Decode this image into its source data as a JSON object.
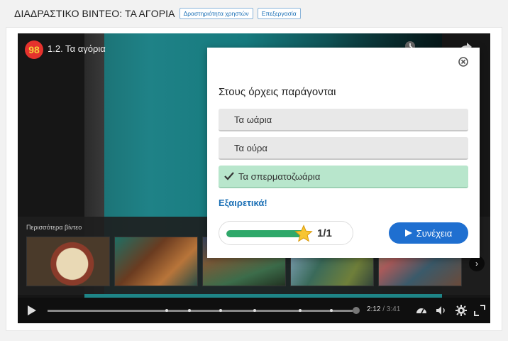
{
  "header": {
    "title": "ΔΙΑΔΡΑΣΤΙΚΟ ΒΙΝΤΕΟ: ΤΑ ΑΓΟΡΙΑ",
    "user_activity_label": "Δραστηριότητα χρηστών",
    "edit_label": "Επεξεργασία"
  },
  "video": {
    "channel_logo_text": "98",
    "title": "1.2. Τα αγόρια",
    "more_videos_label": "Περισσότερα βίντεο",
    "current_time": "2:12",
    "total_time": "/ 3:41",
    "progress_fraction": 1.0
  },
  "quiz": {
    "question": "Στους όρχεις παράγονται",
    "answers": [
      {
        "label": "Τα ωάρια",
        "state": "normal"
      },
      {
        "label": "Τα ούρα",
        "state": "normal"
      },
      {
        "label": "Τα σπερματοζωάρια",
        "state": "correct"
      }
    ],
    "feedback": "Εξαιρετικά!",
    "score": "1/1",
    "score_fraction": 1.0,
    "continue_label": "Συνέχεια"
  },
  "colors": {
    "accent_blue": "#1f6fd0",
    "correct_green": "#b8e6cc",
    "progress_green": "#2fa86a",
    "logo_red": "#e5322d"
  },
  "icons": [
    "play-icon",
    "settings-icon",
    "volume-icon",
    "fullscreen-icon",
    "share-icon",
    "clock-icon",
    "close-icon",
    "check-icon",
    "star-icon",
    "arrow-right-icon"
  ]
}
